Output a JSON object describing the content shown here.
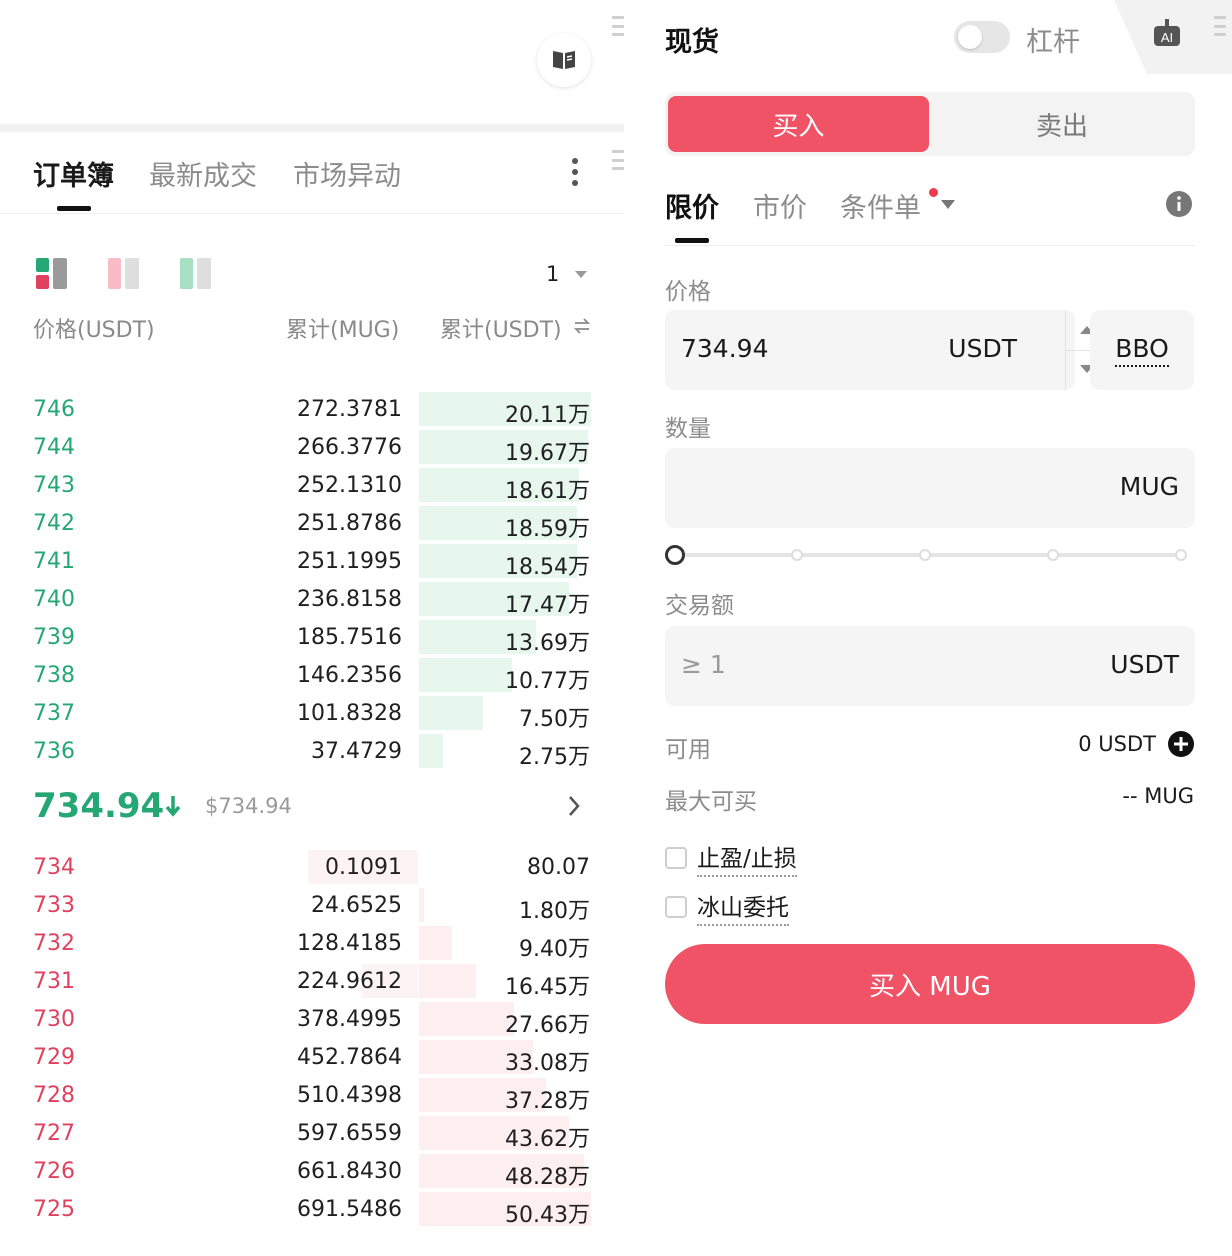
{
  "orderbook": {
    "tabs": [
      "订单簿",
      "最新成交",
      "市场异动"
    ],
    "precision": "1",
    "headers": {
      "price": "价格(USDT)",
      "cum_base": "累计(MUG)",
      "cum_quote": "累计(USDT)"
    },
    "bids": [
      {
        "price": "746",
        "amount": "272.3781",
        "total": "20.11万",
        "depth_pct": 100
      },
      {
        "price": "744",
        "amount": "266.3776",
        "total": "19.67万",
        "depth_pct": 98
      },
      {
        "price": "743",
        "amount": "252.1310",
        "total": "18.61万",
        "depth_pct": 93
      },
      {
        "price": "742",
        "amount": "251.8786",
        "total": "18.59万",
        "depth_pct": 92
      },
      {
        "price": "741",
        "amount": "251.1995",
        "total": "18.54万",
        "depth_pct": 92
      },
      {
        "price": "740",
        "amount": "236.8158",
        "total": "17.47万",
        "depth_pct": 87
      },
      {
        "price": "739",
        "amount": "185.7516",
        "total": "13.69万",
        "depth_pct": 68
      },
      {
        "price": "738",
        "amount": "146.2356",
        "total": "10.77万",
        "depth_pct": 54
      },
      {
        "price": "737",
        "amount": "101.8328",
        "total": "7.50万",
        "depth_pct": 37
      },
      {
        "price": "736",
        "amount": "37.4729",
        "total": "2.75万",
        "depth_pct": 14
      }
    ],
    "asks": [
      {
        "price": "734",
        "amount": "0.1091",
        "total": "80.07",
        "depth_pct": 0,
        "amount_pct": 55
      },
      {
        "price": "733",
        "amount": "24.6525",
        "total": "1.80万",
        "depth_pct": 3,
        "amount_pct": 0
      },
      {
        "price": "732",
        "amount": "128.4185",
        "total": "9.40万",
        "depth_pct": 19,
        "amount_pct": 0
      },
      {
        "price": "731",
        "amount": "224.9612",
        "total": "16.45万",
        "depth_pct": 33,
        "amount_pct": 28
      },
      {
        "price": "730",
        "amount": "378.4995",
        "total": "27.66万",
        "depth_pct": 55,
        "amount_pct": 0
      },
      {
        "price": "729",
        "amount": "452.7864",
        "total": "33.08万",
        "depth_pct": 66,
        "amount_pct": 0
      },
      {
        "price": "728",
        "amount": "510.4398",
        "total": "37.28万",
        "depth_pct": 74,
        "amount_pct": 0
      },
      {
        "price": "727",
        "amount": "597.6559",
        "total": "43.62万",
        "depth_pct": 87,
        "amount_pct": 0
      },
      {
        "price": "726",
        "amount": "661.8430",
        "total": "48.28万",
        "depth_pct": 96,
        "amount_pct": 0
      },
      {
        "price": "725",
        "amount": "691.5486",
        "total": "50.43万",
        "depth_pct": 100,
        "amount_pct": 0
      }
    ],
    "last_price": "734.94",
    "last_price_usd": "$734.94"
  },
  "trade": {
    "spot_label": "现货",
    "leverage_label": "杠杆",
    "buy_tab": "买入",
    "sell_tab": "卖出",
    "order_types": [
      "限价",
      "市价",
      "条件单"
    ],
    "price_label": "价格",
    "price_value": "734.94",
    "price_unit": "USDT",
    "bbo_label": "BBO",
    "qty_label": "数量",
    "qty_value": "",
    "qty_unit": "MUG",
    "slider_pct": 0,
    "amount_label": "交易额",
    "amount_placeholder": "≥ 1",
    "amount_unit": "USDT",
    "available_label": "可用",
    "available_value": "0 USDT",
    "max_buy_label": "最大可买",
    "max_buy_value": "-- MUG",
    "tpsl_label": "止盈/止损",
    "iceberg_label": "冰山委托",
    "buy_button": "买入 MUG"
  },
  "colors": {
    "bid": "#25a775",
    "ask": "#e0415e",
    "buy": "#f05366"
  },
  "icons": [
    "book-icon",
    "kebab-menu-icon",
    "swap-icon",
    "down-arrow-icon",
    "chevron-right-icon",
    "robot-icon",
    "info-icon",
    "plus-icon"
  ]
}
